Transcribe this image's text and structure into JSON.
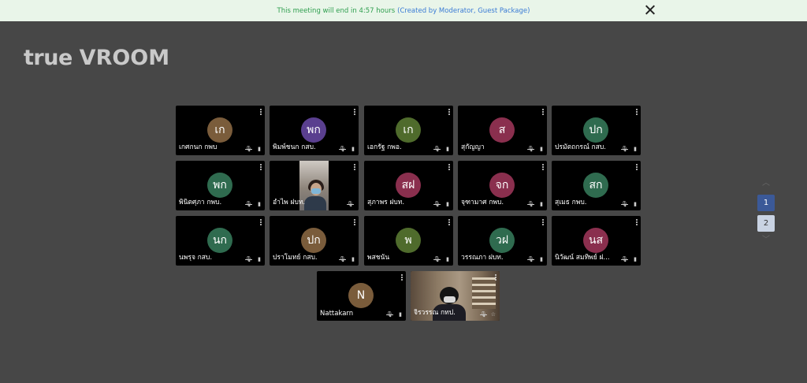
{
  "banner": {
    "text": "This meeting will end in 4:57 hours",
    "link": "(Created by Moderator, Guest Package)"
  },
  "logo": {
    "part1": "true",
    "part2": "VROOM"
  },
  "participants": [
    {
      "name": "เกศกนก กพบ",
      "initials": "เก",
      "color": "#7a5c3b",
      "video": false
    },
    {
      "name": "พิมพ์ชนก กสบ.",
      "initials": "พก",
      "color": "#5a3f8f",
      "video": false
    },
    {
      "name": "เอกรัฐ กพอ.",
      "initials": "เก",
      "color": "#4f6b2c",
      "video": false
    },
    {
      "name": "สุกัญญา",
      "initials": "ส",
      "color": "#8a2f4e",
      "video": false
    },
    {
      "name": "ปรมัตถกรณ์ กสบ.",
      "initials": "ปก",
      "color": "#2f6b4f",
      "video": false
    },
    {
      "name": "พินิตศุภา กพบ.",
      "initials": "พก",
      "color": "#2f6b4f",
      "video": false
    },
    {
      "name": "อำไพ ฝบท.",
      "initials": "",
      "color": "#000000",
      "video": true
    },
    {
      "name": "สุภาพร ฝบท.",
      "initials": "สฝ",
      "color": "#8a2f4e",
      "video": false
    },
    {
      "name": "จุฑามาศ กพบ.",
      "initials": "จก",
      "color": "#8a2f4e",
      "video": false
    },
    {
      "name": "สุเมธ กพบ.",
      "initials": "สก",
      "color": "#2f6b4f",
      "video": false
    },
    {
      "name": "นพรุจ กสบ.",
      "initials": "นก",
      "color": "#2f6b4f",
      "video": false
    },
    {
      "name": "ปราโมทย์ กสบ.",
      "initials": "ปก",
      "color": "#7a5c3b",
      "video": false
    },
    {
      "name": "พสชนัน",
      "initials": "พ",
      "color": "#4f6b2c",
      "video": false
    },
    {
      "name": "วรรณภา ฝบท.",
      "initials": "วฝ",
      "color": "#2f6b4f",
      "video": false
    },
    {
      "name": "นิวัฒน์ สมทิพย์ ฝ...",
      "initials": "นส",
      "color": "#8a2f4e",
      "video": false
    },
    {
      "name": "Nattakarn",
      "initials": "N",
      "color": "#7a5c3b",
      "video": false
    },
    {
      "name": "จิรวรรณ กทป.",
      "initials": "",
      "color": "#000000",
      "video": true
    }
  ],
  "pagination": {
    "pages": [
      "1",
      "2"
    ],
    "current": "1"
  }
}
